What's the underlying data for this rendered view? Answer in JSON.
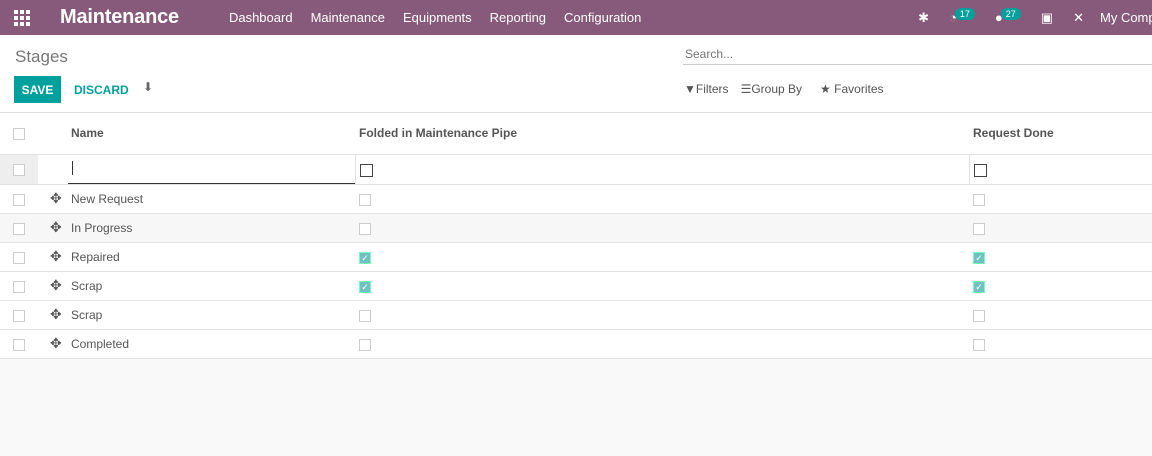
{
  "nav": {
    "app_title": "Maintenance",
    "menu": [
      "Dashboard",
      "Maintenance",
      "Equipments",
      "Reporting",
      "Configuration"
    ],
    "activity_count": "17",
    "message_count": "27",
    "company": "My Company"
  },
  "control": {
    "title": "Stages",
    "save_label": "SAVE",
    "discard_label": "DISCARD",
    "search_placeholder": "Search...",
    "filters_label": "Filters",
    "groupby_label": "Group By",
    "favorites_label": "Favorites"
  },
  "table": {
    "columns": [
      "Name",
      "Folded in Maintenance Pipe",
      "Request Done"
    ],
    "rows": [
      {
        "name": "New Request",
        "folded": false,
        "done": false
      },
      {
        "name": "In Progress",
        "folded": false,
        "done": false
      },
      {
        "name": "Repaired",
        "folded": true,
        "done": true
      },
      {
        "name": "Scrap",
        "folded": true,
        "done": true
      },
      {
        "name": "Scrap",
        "folded": false,
        "done": false
      },
      {
        "name": "Completed",
        "folded": false,
        "done": false
      }
    ]
  },
  "colors": {
    "navbar": "#875a7b",
    "accent": "#00a09d"
  }
}
